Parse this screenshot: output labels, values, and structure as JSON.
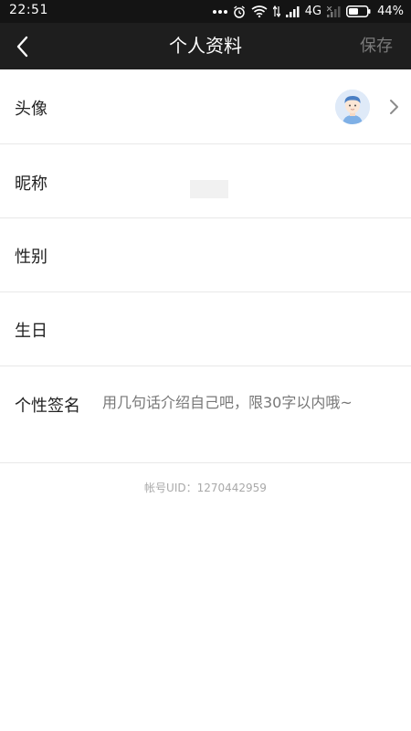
{
  "status_bar": {
    "time": "22:51",
    "network": "4G",
    "battery": "44%",
    "icons": [
      "dots-icon",
      "alarm-icon",
      "wifi-icon",
      "data-arrows-icon",
      "signal-icon",
      "signal-weak-icon",
      "battery-icon"
    ]
  },
  "nav": {
    "title": "个人资料",
    "save_label": "保存",
    "back_icon": "back-arrow-icon"
  },
  "rows": {
    "avatar_label": "头像",
    "nickname_label": "昵称",
    "gender_label": "性别",
    "birthday_label": "生日",
    "signature_label": "个性签名",
    "signature_placeholder": "用几句话介绍自己吧，限30字以内哦~"
  },
  "account": {
    "uid_text": "帐号UID：1270442959"
  },
  "colors": {
    "status_bar_bg": "#141414",
    "nav_bg": "#1e1e1e",
    "divider": "#e8e8e8",
    "save_disabled": "#7a7a7a"
  }
}
